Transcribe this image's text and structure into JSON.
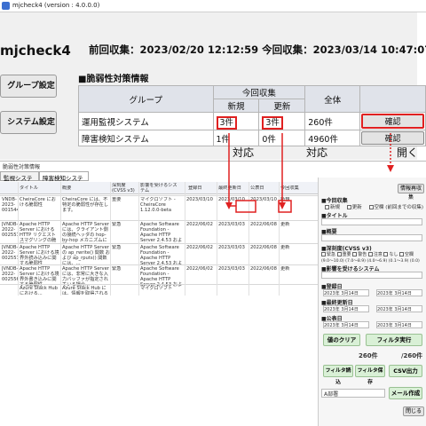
{
  "window": {
    "title": "mjcheck4 (version : 4.0.0.0)"
  },
  "app": {
    "brand": "mjcheck4",
    "last_info": "前回収集：2023/02/20 12:12:59  今回収集：2023/03/14 10:47:07"
  },
  "sidebar": {
    "btn1": "グループ設定",
    "btn2": "システム設定"
  },
  "section": {
    "title": "■脆弱性対策情報"
  },
  "vtable": {
    "h_group": "グループ",
    "h_current": "今回収集",
    "h_new": "新規",
    "h_update": "更新",
    "h_total": "全体",
    "rows": [
      {
        "group": "運用監視システム",
        "new": "3件",
        "update": "3件",
        "total": "260件",
        "action": "確認"
      },
      {
        "group": "障害検知システム",
        "new": "1件",
        "update": "0件",
        "total": "4960件",
        "action": "確認"
      }
    ]
  },
  "annot": {
    "a1": "対応",
    "a2": "対応",
    "a3": "開く"
  },
  "win2": {
    "title": "脆弱性対策情報",
    "tabs": [
      "監視システム",
      "障害検知システム"
    ],
    "columns": [
      "",
      "タイトル",
      "概要",
      "深刻度 (CVSS v3)",
      "影響を受けるシステム",
      "登録日",
      "最終更新日",
      "公表日",
      "今回収集"
    ],
    "rows": [
      {
        "id": "VNDB-2023-001544",
        "title": "CheiraCore における脆弱性",
        "summary": "CheiraCore には、不特定の脆弱性が存在します。",
        "sev": "重要",
        "sys": "マイクロソフト -CheiraCore 1.12.0.0-beta",
        "reg": "2023/03/10",
        "upd": "2023/03/10",
        "pub": "2023/03/10",
        "stat": "新規"
      },
      {
        "id": "JVNDB-2022-002557",
        "title": "Apache HTTP Server における HTTP リクエストスマグリングの脆弱性",
        "summary": "Apache HTTP Server には、クライアント側の接続ヘッダの hop-by-hop メカニズムに関する...",
        "sev": "緊急",
        "sys": "Apache Software Foundation -Apache HTTP Server 2.4.53 およびそれ以前",
        "reg": "2022/06/02",
        "upd": "2023/03/03",
        "pub": "2022/06/08",
        "stat": "更新"
      },
      {
        "id": "JVNDB-2022-002557",
        "title": "Apache HTTP Server における境界外読み込みに関する脆弱性",
        "summary": "Apache HTTP Server の ap_rwrite() 関数 および ap_rputs() 関数には、...",
        "sev": "緊急",
        "sys": "Apache Software Foundation -Apache HTTP Server 2.4.53 およびそれ以前",
        "reg": "2022/06/02",
        "upd": "2023/03/03",
        "pub": "2022/06/08",
        "stat": "更新"
      },
      {
        "id": "JVNDB-2022-002556",
        "title": "Apache HTTP Server における境界外書き込みに関する脆弱性",
        "summary": "Apache HTTP Server には、非常に大きな入力バッファが指定されている場合...",
        "sev": "緊急",
        "sys": "Apache Software Foundation -Apache HTTP Server 2.4.53 およびそれ以前",
        "reg": "2022/06/02",
        "upd": "2023/03/03",
        "pub": "2022/06/08",
        "stat": "更新"
      },
      {
        "id": "",
        "title": "Azure Stack Hub における...",
        "summary": "Azure Stack Hub には、情報を取得される脆弱性...",
        "sev": "",
        "sys": "マイクロソフト",
        "reg": "",
        "upd": "",
        "pub": "",
        "stat": ""
      }
    ]
  },
  "panel": {
    "refetch": "情報再収集",
    "l_status": "■今回収集",
    "cb_status": [
      "新規",
      "更新",
      "空欄 (前回までの収集)"
    ],
    "l_title": "■タイトル",
    "l_summary": "■概要",
    "l_sev": "■深刻度(CVSS v3)",
    "cb_sev": [
      "緊急",
      "重要",
      "警告",
      "注意",
      "なし",
      "空欄"
    ],
    "sev_note": "(9.0〜10.0) (7.0〜8.9) (4.0〜6.9) (0.1〜3.9) (0.0)",
    "l_sys": "■影響を受けるシステム",
    "l_reg": "■登録日",
    "l_upd": "■最終更新日",
    "l_pub": "■公表日",
    "date_a": "2023年 3月14日",
    "date_b": "2023年 3月14日",
    "btn_clear": "値のクリア",
    "btn_filter": "フィルタ実行",
    "count_a": "260件",
    "count_b": "/260件",
    "btn_read": "フィルタ読込",
    "btn_save": "フィルタ保存",
    "btn_csv": "CSV出力",
    "select_val": "A部署",
    "btn_mail": "メール作成",
    "btn_close": "閉じる"
  }
}
